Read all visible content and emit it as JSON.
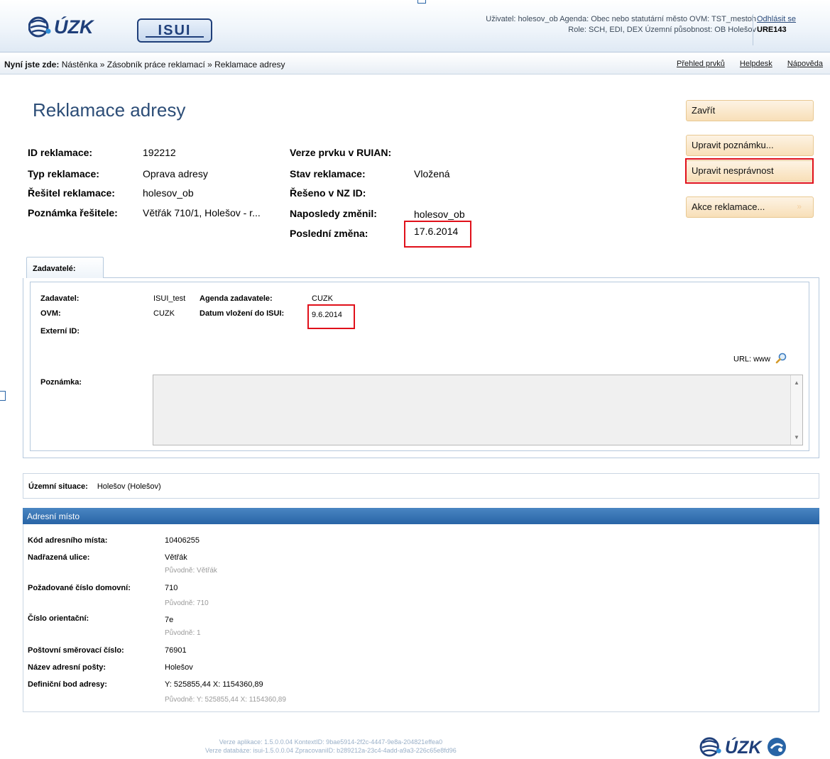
{
  "header": {
    "logo_text": "ÚZK",
    "isui_logo": "ISUI",
    "user_line1": "Uživatel: holesov_ob   Agenda: Obec nebo statutární město   OVM: TST_mestoh",
    "user_line2": "Role: SCH, EDI, DEX   Územní působnost: OB Holešov",
    "logout": "Odhlásit se",
    "ure": "URE143"
  },
  "breadcrumb": {
    "prefix": "Nyní jste zde:",
    "path": "Nástěnka » Zásobník práce reklamací » Reklamace adresy"
  },
  "toplinks": [
    "Přehled prvků",
    "Helpdesk",
    "Nápověda"
  ],
  "page_title": "Reklamace adresy",
  "details": {
    "left": [
      {
        "label": "ID reklamace:",
        "value": "192212"
      },
      {
        "label": "Typ reklamace:",
        "value": "Oprava adresy"
      },
      {
        "label": "Řešitel reklamace:",
        "value": "holesov_ob"
      },
      {
        "label": "Poznámka řešitele:",
        "value": "Větřák 710/1, Holešov - r..."
      }
    ],
    "right": [
      {
        "label": "Verze prvku v RUIAN:",
        "value": ""
      },
      {
        "label": "Stav reklamace:",
        "value": "Vložená"
      },
      {
        "label": "Řešeno v NZ ID:",
        "value": ""
      },
      {
        "label": "Naposledy změnil:",
        "value": "holesov_ob"
      },
      {
        "label": "Poslední změna:",
        "value": "17.6.2014"
      }
    ]
  },
  "buttons": {
    "close": "Zavřít",
    "edit_note": "Upravit poznámku...",
    "edit_incorrect": "Upravit nesprávnost",
    "actions": "Akce reklamace...",
    "actions_chev": "»"
  },
  "zadavatele": {
    "tab": "Zadavatelé:",
    "zadavatel_label": "Zadavatel:",
    "zadavatel_value": "ISUI_test",
    "agenda_label": "Agenda zadavatele:",
    "agenda_value": "CUZK",
    "ovm_label": "OVM:",
    "ovm_value": "CUZK",
    "datum_label": "Datum vložení do ISUI:",
    "datum_value": "9.6.2014",
    "externi_label": "Externí ID:",
    "url_label": "URL: www",
    "poznamka_label": "Poznámka:"
  },
  "uzemni": {
    "label": "Územní situace:",
    "value": "Holešov (Holešov)"
  },
  "adresni_misto": {
    "header": "Adresní místo",
    "rows": [
      {
        "label": "Kód adresního místa:",
        "value": "10406255",
        "orig": ""
      },
      {
        "label": "Nadřazená ulice:",
        "value": "Větřák",
        "orig": "Původně: Větřák"
      },
      {
        "label": "Požadované číslo domovní:",
        "value": "710",
        "orig": "Původně: 710"
      },
      {
        "label": "Číslo orientační:",
        "value": "7e",
        "orig": "Původně: 1"
      },
      {
        "label": "Poštovní směrovací číslo:",
        "value": "76901",
        "orig": ""
      },
      {
        "label": "Název adresní pošty:",
        "value": "Holešov",
        "orig": ""
      },
      {
        "label": "Definiční bod adresy:",
        "value": "Y: 525855,44 X: 1154360,89",
        "orig": "Původně: Y: 525855,44 X: 1154360,89"
      }
    ]
  },
  "footer": {
    "line1": "Verze aplikace: 1.5.0.0.04 KontextID: 9bae5914-2f2c-4447-9e8a-204821effea0",
    "line2": "Verze databáze: isui-1.5.0.0.04 ZpracovaniID: b289212a-23c4-4add-a9a3-226c65e8fd96"
  },
  "colors": {
    "accent": "#2864a6",
    "title": "#2c4d77",
    "highlight": "#e0101a",
    "button_bg": "#f8dfb8"
  }
}
